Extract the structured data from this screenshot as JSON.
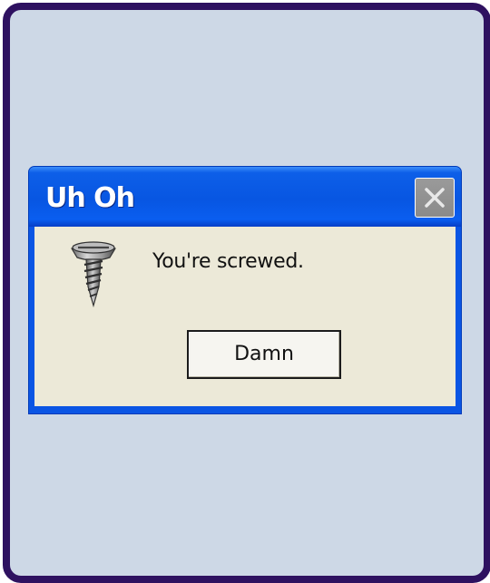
{
  "dialog": {
    "title": "Uh Oh",
    "message": "You're screwed.",
    "icon": "screw-icon",
    "close_icon": "close-icon",
    "button_label": "Damn"
  },
  "colors": {
    "frame_border": "#2e1160",
    "background": "#cdd8e6",
    "titlebar_blue": "#0856e2",
    "client_beige": "#ece9d8",
    "close_button_gray": "#8a8a8a"
  }
}
